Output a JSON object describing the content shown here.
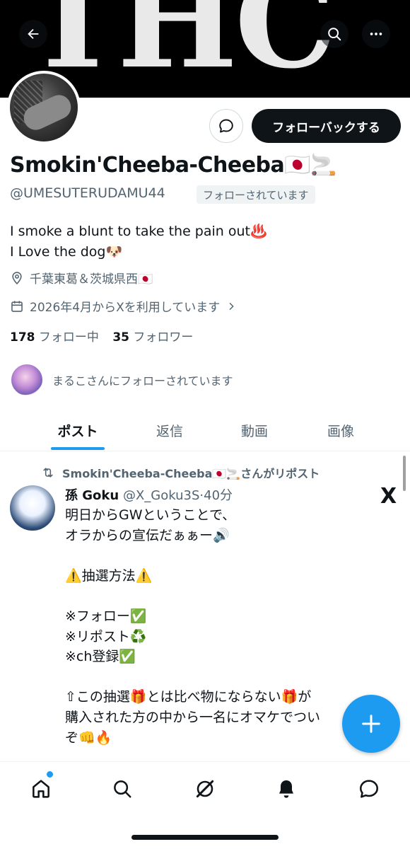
{
  "banner": {
    "art_text": "THC"
  },
  "profile": {
    "display_name": "Smokin'Cheeba-Cheeba🇯🇵🚬",
    "handle": "@UMESUTERUDAMU44",
    "follows_you": "フォローされています",
    "follow_back_label": "フォローバックする",
    "bio_line1": "I smoke a blunt to take the pain out♨️",
    "bio_line2": "I Love the dog🐶",
    "location": "千葉東葛＆茨城県西🇯🇵",
    "joined": "2026年4月からXを利用しています",
    "following_count": "178",
    "following_label": "フォロー中",
    "followers_count": "35",
    "followers_label": "フォロワー",
    "followed_by_text": "まるこさんにフォローされています"
  },
  "tabs": [
    {
      "label": "ポスト"
    },
    {
      "label": "返信"
    },
    {
      "label": "動画"
    },
    {
      "label": "画像"
    }
  ],
  "post": {
    "repost_text": "Smokin'Cheeba-Cheeba🇯🇵🚬さんがリポスト",
    "author_name": "孫 Goku",
    "author_handle": "@X_Goku3S",
    "separator": "·",
    "time": "40分",
    "body": "明日からGWということで、\nオラからの宣伝だぁぁー🔊\n\n⚠️抽選方法⚠️\n\n※フォロー✅\n※リポスト♻️\n※ch登録✅\n\n⇧この抽選🎁とは比べ物にならない🎁が\n購入された方の中から一名にオマケでつい\nぞ👊🔥",
    "x_logo": "X"
  },
  "icons": {
    "back": "back-arrow-icon",
    "search": "search-icon",
    "more": "more-icon",
    "message": "message-icon",
    "compose": "plus-icon",
    "nav": [
      "home-icon",
      "search-icon",
      "grok-icon",
      "bell-icon",
      "messages-icon"
    ]
  },
  "colors": {
    "accent": "#1d9bf0",
    "text_primary": "#0f1419",
    "text_secondary": "#536471"
  }
}
